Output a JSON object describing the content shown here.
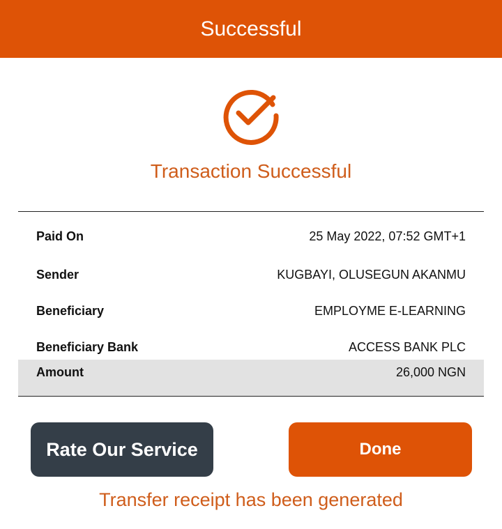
{
  "header": {
    "title": "Successful"
  },
  "status": {
    "icon": "check-circle-icon",
    "title": "Transaction Successful"
  },
  "details": [
    {
      "label": "Paid On",
      "value": "25 May 2022, 07:52 GMT+1"
    },
    {
      "label": "Sender",
      "value": "KUGBAYI, OLUSEGUN AKANMU"
    },
    {
      "label": "Beneficiary",
      "value": "EMPLOYME E-LEARNING"
    },
    {
      "label": "Beneficiary Bank",
      "value": "ACCESS BANK PLC"
    },
    {
      "label": "Amount",
      "value": "26,000 NGN"
    }
  ],
  "actions": {
    "rate_label": "Rate Our Service",
    "done_label": "Done"
  },
  "footer": {
    "note": "Transfer receipt has been generated"
  },
  "colors": {
    "accent": "#de5306",
    "dark_button": "#343e48",
    "status_text": "#cf5d1b",
    "shaded_row": "#e2e2e2"
  }
}
